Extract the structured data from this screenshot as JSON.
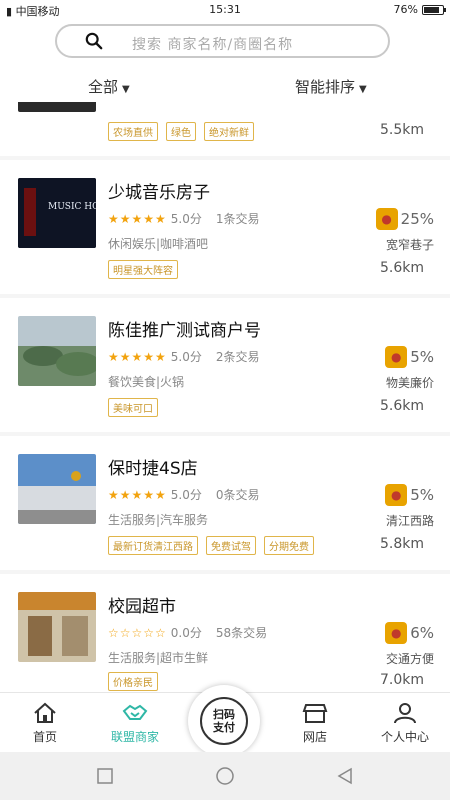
{
  "status": {
    "carrier": "中国移动",
    "time": "15:31",
    "battery": "76%"
  },
  "search": {
    "placeholder": "搜索 商家名称/商圈名称"
  },
  "filters": {
    "all": "全部",
    "sort": "智能排序"
  },
  "partial": {
    "tags": [
      "农场直供",
      "绿色",
      "绝对新鲜"
    ],
    "distance": "5.5km"
  },
  "shops": [
    {
      "name": "少城音乐房子",
      "score": "5.0分",
      "deals": "1条交易",
      "category": "休闲娱乐|咖啡酒吧",
      "tags": [
        "明星强大阵容"
      ],
      "discount": "25%",
      "place": "宽窄巷子",
      "distance": "5.6km",
      "stars_filled": 5,
      "thumb_text": "MUSIC HOUSE"
    },
    {
      "name": "陈佳推广测试商户号",
      "score": "5.0分",
      "deals": "2条交易",
      "category": "餐饮美食|火锅",
      "tags": [
        "美味可口"
      ],
      "discount": "5%",
      "place": "物美廉价",
      "distance": "5.6km",
      "stars_filled": 5
    },
    {
      "name": "保时捷4S店",
      "score": "5.0分",
      "deals": "0条交易",
      "category": "生活服务|汽车服务",
      "tags": [
        "最新订货清江西路",
        "免费试驾",
        "分期免费"
      ],
      "discount": "5%",
      "place": "清江西路",
      "distance": "5.8km",
      "stars_filled": 5
    },
    {
      "name": "校园超市",
      "score": "0.0分",
      "deals": "58条交易",
      "category": "生活服务|超市生鲜",
      "tags": [
        "价格亲民"
      ],
      "discount": "6%",
      "place": "交通方便",
      "distance": "7.0km",
      "stars_filled": 0
    }
  ],
  "tabbar": {
    "home": "首页",
    "alliance": "联盟商家",
    "scan_line1": "扫码",
    "scan_line2": "支付",
    "store": "网店",
    "profile": "个人中心"
  },
  "colors": {
    "accent": "#2fb7a6",
    "star": "#f2a30f",
    "tag": "#c9962a",
    "badge": "#e8a300"
  }
}
